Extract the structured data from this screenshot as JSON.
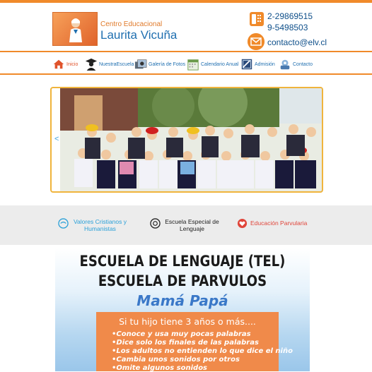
{
  "header": {
    "school_sub": "Centro Educacional",
    "school_name": "Laurita Vicuña",
    "phone1": "2-29869515",
    "phone2": "9-5498503",
    "email": "contacto@elv.cl"
  },
  "nav": {
    "items": [
      {
        "label": "Inicio",
        "icon": "home-icon"
      },
      {
        "label": "NuestraEscuela",
        "icon": "graduate-icon"
      },
      {
        "label": "Galería de Fotos",
        "icon": "photos-icon"
      },
      {
        "label": "Calendario Anual",
        "icon": "calendar-icon"
      },
      {
        "label": "Admisión",
        "icon": "admission-icon"
      },
      {
        "label": "Contacto",
        "icon": "contact-icon"
      }
    ]
  },
  "hero": {
    "prev_arrow": "<"
  },
  "features": [
    {
      "label": "Valores Cristianos y Humanistas",
      "color": "#2aa0d8"
    },
    {
      "label": "Escuela Especial de Lenguaje",
      "color": "#222222"
    },
    {
      "label": "Educación Parvularia",
      "color": "#e0453a"
    }
  ],
  "banner": {
    "line1": "ESCUELA DE LENGUAJE (TEL)",
    "line2": "ESCUELA DE PARVULOS",
    "line3": "Mamá Papá",
    "box_title": "Si tu hijo tiene 3 años  o más....",
    "bullets": [
      "•Conoce y usa muy pocas palabras",
      "•Dice solo los finales de las palabras",
      "•Los adultos no entienden lo que dice el niño",
      "•Cambia unos sonidos por otros",
      "•Omite algunos sonidos"
    ]
  },
  "colors": {
    "accent": "#f08a2a",
    "brand_blue": "#1f6fb0"
  }
}
